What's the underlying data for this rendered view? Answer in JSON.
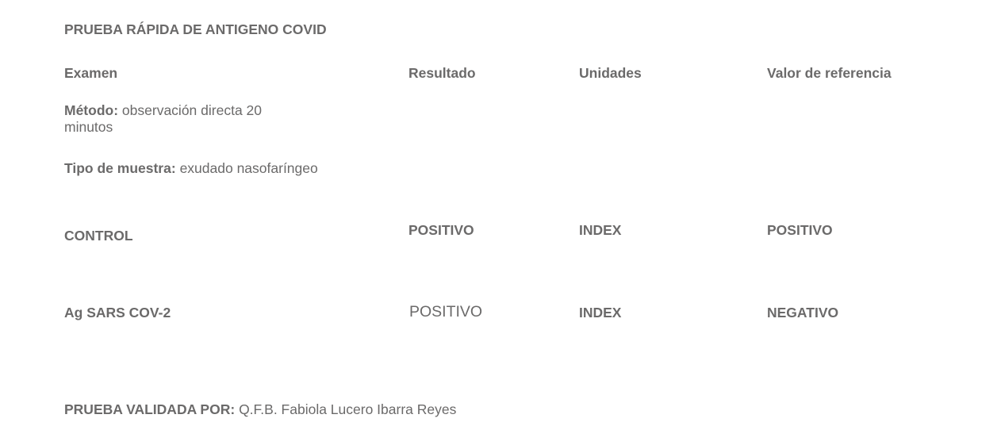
{
  "title": "PRUEBA RÁPIDA DE ANTIGENO COVID",
  "headers": {
    "exam": "Examen",
    "result": "Resultado",
    "units": "Unidades",
    "reference": "Valor de referencia"
  },
  "method": {
    "label": "Método:",
    "value_line1": "observación directa 20",
    "value_line2": "minutos"
  },
  "sample": {
    "label": "Tipo de muestra:",
    "value": "exudado nasofaríngeo"
  },
  "rows": [
    {
      "exam": "CONTROL",
      "result": "POSITIVO",
      "units": "INDEX",
      "reference": "POSITIVO"
    },
    {
      "exam": "Ag SARS COV-2",
      "result": "POSITIVO",
      "units": "INDEX",
      "reference": "NEGATIVO"
    }
  ],
  "validated": {
    "label": "PRUEBA VALIDADA POR:",
    "value": "Q.F.B. Fabiola Lucero Ibarra Reyes"
  }
}
